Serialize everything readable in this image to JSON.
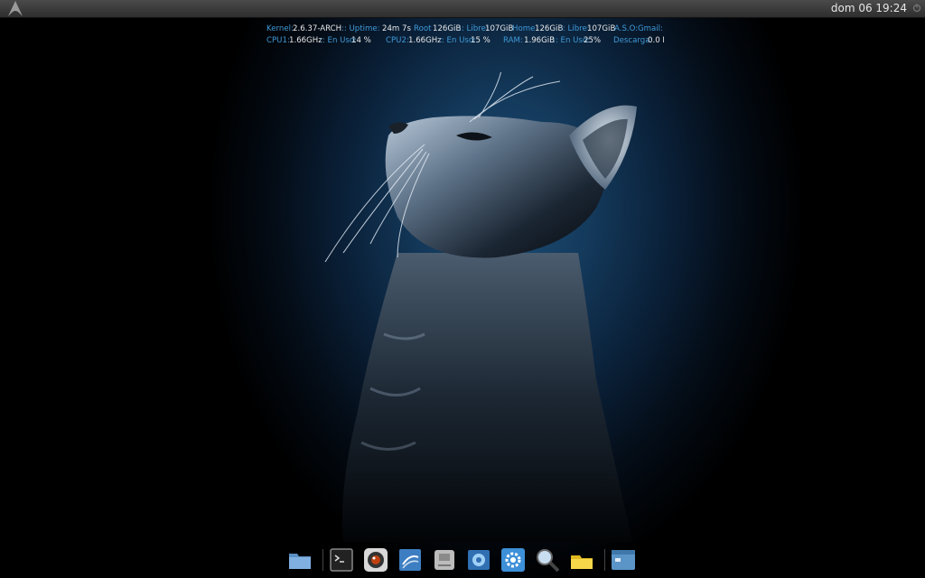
{
  "panel": {
    "clock": "dom 06 19:24",
    "logo_icon": "arch-logo-icon",
    "right_icon": "power-icon"
  },
  "conky": {
    "row1": {
      "kernel_label": "Kernel:",
      "kernel_value": "2.6.37-ARCH",
      "uptime_label": ":: Uptime:",
      "uptime_value": "24m 7s",
      "root_label": "Root",
      "root_value": "126GiB",
      "root_free_label": ":: Libre:",
      "root_free_value": "107GiB",
      "home_label": "Home",
      "home_value": "126GiB",
      "home_free_label": ":: Libre:",
      "home_free_value": "107GiB",
      "aso_label": "A.S.O:",
      "gmail_label": "Gmail:"
    },
    "row2": {
      "cpu1_label": "CPU1:",
      "cpu1_value": "1.66GHz",
      "cpu1_use_label": ":: En Uso:",
      "cpu1_use_value": "14 %",
      "cpu2_label": "CPU2:",
      "cpu2_value": "1.66GHz",
      "cpu2_use_label": ":: En Uso:",
      "cpu2_use_value": "15 %",
      "ram_label": "RAM:",
      "ram_value": "1.96GiB",
      "ram_use_label": ":: En Uso:",
      "ram_use_value": "25%",
      "download_label": "Descarga:",
      "download_value": "0.0 I"
    }
  },
  "dock": {
    "items": [
      {
        "icon": "folder-icon"
      },
      {
        "icon": "terminal-icon"
      },
      {
        "icon": "camera-lens-icon"
      },
      {
        "icon": "writer-icon"
      },
      {
        "icon": "drive-icon"
      },
      {
        "icon": "browser-icon"
      },
      {
        "icon": "settings-icon"
      },
      {
        "icon": "search-icon"
      },
      {
        "icon": "files-icon"
      },
      {
        "icon": "window-icon"
      }
    ]
  },
  "colors": {
    "label": "#3f9ad8",
    "value": "#e9e9e9",
    "background_glow": "#1d4f78"
  }
}
